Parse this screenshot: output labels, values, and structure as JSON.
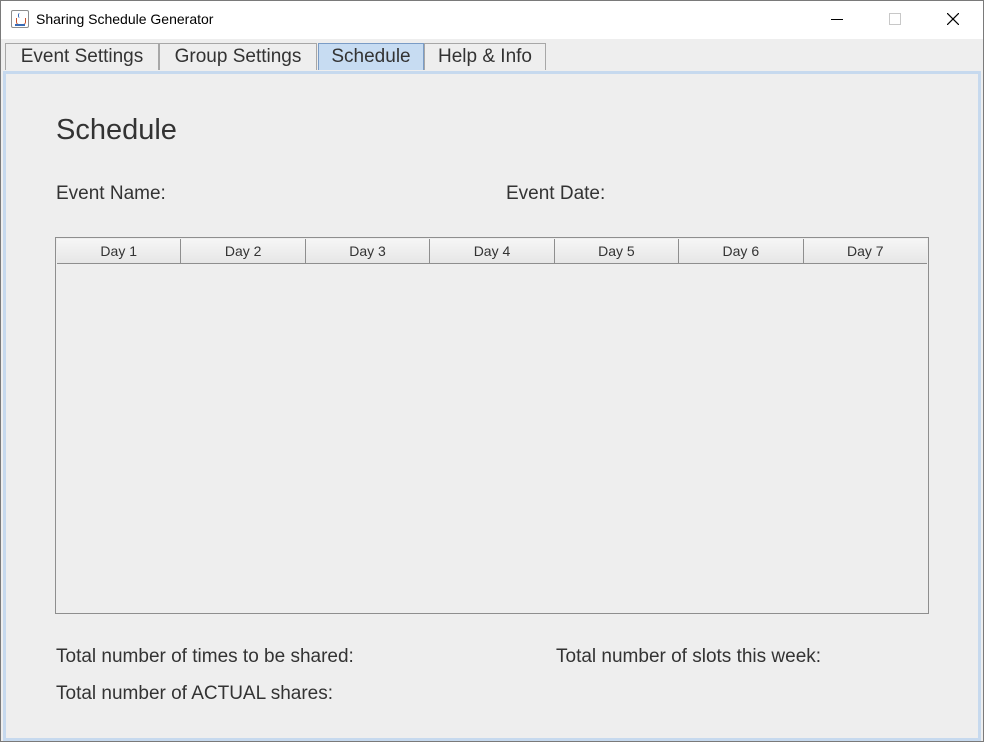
{
  "window": {
    "title": "Sharing Schedule Generator"
  },
  "tabs": [
    {
      "label": "Event Settings",
      "selected": false
    },
    {
      "label": "Group Settings",
      "selected": false
    },
    {
      "label": "Schedule",
      "selected": true
    },
    {
      "label": "Help & Info",
      "selected": false
    }
  ],
  "schedule": {
    "heading": "Schedule",
    "event_name_label": "Event Name:",
    "event_date_label": "Event Date:",
    "table": {
      "columns": [
        "Day 1",
        "Day 2",
        "Day 3",
        "Day 4",
        "Day 5",
        "Day 6",
        "Day 7"
      ],
      "rows": []
    },
    "total_times_label": "Total number of times to be shared:",
    "total_slots_label": "Total number of slots this week:",
    "actual_shares_label": "Total number of ACTUAL shares:"
  },
  "colors": {
    "background": "#eeeeee",
    "selected_tab": "#c7dcf2",
    "panel_border": "#c6d9ee",
    "text": "#333333"
  },
  "icons": {
    "app": "java-cup-icon",
    "minimize": "minimize-icon",
    "maximize": "maximize-icon",
    "close": "close-icon"
  }
}
